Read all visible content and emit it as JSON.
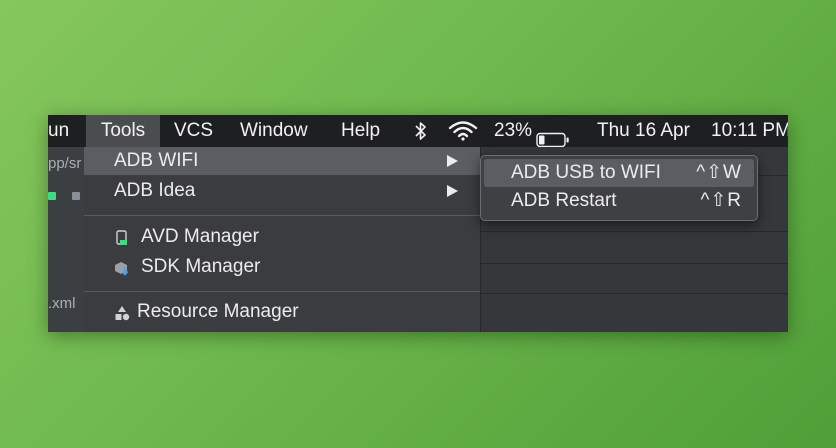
{
  "menubar": {
    "items": [
      {
        "label": "un"
      },
      {
        "label": "Tools"
      },
      {
        "label": "VCS"
      },
      {
        "label": "Window"
      },
      {
        "label": "Help"
      }
    ],
    "status": {
      "battery_percent": "23%",
      "battery_level": 0.23,
      "date": "Thu 16 Apr",
      "time": "10:11 PM"
    }
  },
  "ide": {
    "path_fragment": "pp/sr",
    "file_fragment": ".xml"
  },
  "tools_menu": {
    "items": [
      {
        "label": "ADB WIFI",
        "has_submenu": true,
        "highlighted": true
      },
      {
        "label": "ADB Idea",
        "has_submenu": true
      },
      {
        "label": "AVD Manager",
        "icon": "device-icon"
      },
      {
        "label": "SDK Manager",
        "icon": "sdk-download-icon"
      },
      {
        "label": "Resource Manager",
        "icon": "resource-shapes-icon"
      }
    ]
  },
  "adb_wifi_submenu": {
    "items": [
      {
        "label": "ADB USB to WIFI",
        "shortcut": "^⇧W",
        "highlighted": true
      },
      {
        "label": "ADB Restart",
        "shortcut": "^⇧R"
      }
    ]
  },
  "colors": {
    "background_light": "#86c75c",
    "background_dark": "#4f9e37",
    "menubar": "#1e1f21",
    "menu": "#3a3c3f",
    "highlight": "#5a5d61",
    "android_green": "#3ddc84",
    "sdk_blue": "#4aa3e8"
  }
}
